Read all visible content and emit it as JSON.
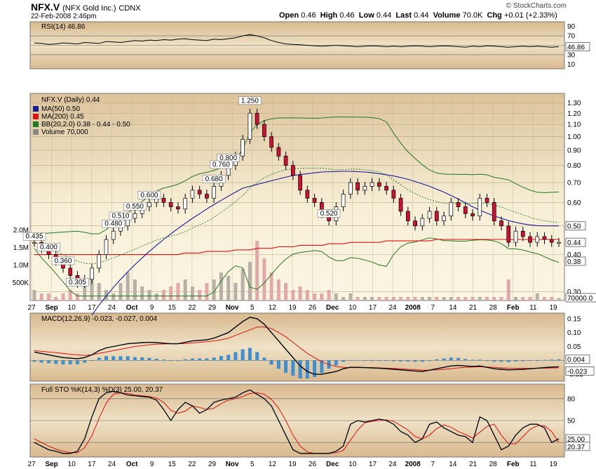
{
  "header": {
    "symbol": "NFX.V",
    "company": "(NFX Gold Inc.)",
    "exchange": "CDNX",
    "date": "22-Feb-2008 2:46pm",
    "brand": "© StockCharts.com",
    "open_label": "Open",
    "open": "0.46",
    "high_label": "High",
    "high": "0.46",
    "low_label": "Low",
    "low": "0.44",
    "last_label": "Last",
    "last": "0.44",
    "volume_label": "Volume",
    "volume": "70.0K",
    "chg_label": "Chg",
    "chg": "+0.01 (+2.33%)"
  },
  "colors": {
    "up_candle": "#ffffff",
    "down_candle": "#cc1133",
    "ma50": "#1a1a99",
    "ma200": "#dd1111",
    "bb": "#227722",
    "volume_up": "#b8b0a6",
    "volume_down": "#e2a8a8",
    "macd_hist": "#3d8fd0",
    "signal": "#dd1111"
  },
  "chart_data": [
    {
      "type": "line",
      "title": "RSI(14) 46.86",
      "series": [
        {
          "name": "RSI(14)",
          "values": [
            55,
            54,
            52,
            53,
            55,
            54,
            53,
            56,
            55,
            54,
            58,
            57,
            56,
            58,
            60,
            59,
            61,
            60,
            62,
            61,
            63,
            64,
            62,
            61,
            60,
            63,
            62,
            64,
            66,
            70,
            73,
            70,
            66,
            60,
            56,
            53,
            52,
            51,
            50,
            49,
            48,
            49,
            50,
            49,
            48,
            47,
            48,
            49,
            48,
            47,
            48,
            47,
            48,
            49,
            48,
            47,
            48,
            49,
            48,
            47,
            46,
            48,
            47,
            49,
            48,
            47,
            46,
            47,
            48,
            47,
            48,
            47,
            46,
            47
          ]
        }
      ],
      "ylim": [
        0,
        100
      ],
      "yticks": [
        "90",
        "70",
        "50",
        "30",
        "10"
      ],
      "last_value": "46.86"
    },
    {
      "type": "candlestick",
      "title": "NFX.V (Daily) 0.44",
      "legend": [
        "MA(50) 0.50",
        "MA(200) 0.45",
        "BB(20,2.0) 0.38 - 0.44 - 0.50",
        "Volume 70,000"
      ],
      "y_scale": "log",
      "ylim": [
        0.28,
        1.4
      ],
      "yticks": [
        "1.30",
        "1.20",
        "1.10",
        "1.00",
        "0.90",
        "0.80",
        "0.70",
        "0.60",
        "0.50",
        "0.40",
        "0.30"
      ],
      "volume_ticks": [
        "2.0M",
        "1.5M",
        "1.0M",
        "500K"
      ],
      "right_labels": [
        "0.50",
        "0.44",
        "0.38",
        "70000.0"
      ],
      "annotations": [
        {
          "text": "1.250",
          "value": 1.25
        },
        {
          "text": "0.800",
          "value": 0.8
        },
        {
          "text": "0.760",
          "value": 0.76
        },
        {
          "text": "0.680",
          "value": 0.68
        },
        {
          "text": "0.600",
          "value": 0.6
        },
        {
          "text": "0.550",
          "value": 0.55
        },
        {
          "text": "0.520",
          "value": 0.52
        },
        {
          "text": "0.510",
          "value": 0.51
        },
        {
          "text": "0.480",
          "value": 0.48
        },
        {
          "text": "0.435",
          "value": 0.435
        },
        {
          "text": "0.400",
          "value": 0.4
        },
        {
          "text": "0.360",
          "value": 0.36
        },
        {
          "text": "0.305",
          "value": 0.305
        }
      ],
      "close": [
        0.44,
        0.42,
        0.4,
        0.38,
        0.36,
        0.34,
        0.32,
        0.33,
        0.36,
        0.4,
        0.45,
        0.48,
        0.5,
        0.53,
        0.55,
        0.58,
        0.6,
        0.62,
        0.6,
        0.58,
        0.57,
        0.62,
        0.66,
        0.64,
        0.62,
        0.68,
        0.74,
        0.8,
        0.86,
        0.98,
        1.2,
        1.1,
        1.0,
        0.92,
        0.86,
        0.8,
        0.74,
        0.66,
        0.62,
        0.6,
        0.55,
        0.52,
        0.58,
        0.64,
        0.7,
        0.66,
        0.68,
        0.7,
        0.68,
        0.66,
        0.62,
        0.56,
        0.52,
        0.5,
        0.53,
        0.56,
        0.52,
        0.54,
        0.6,
        0.58,
        0.55,
        0.54,
        0.62,
        0.6,
        0.52,
        0.5,
        0.44,
        0.48,
        0.46,
        0.44,
        0.46,
        0.45,
        0.44,
        0.44
      ],
      "ma50": [
        null,
        null,
        null,
        null,
        null,
        null,
        null,
        null,
        0.25,
        0.27,
        0.29,
        0.31,
        0.33,
        0.35,
        0.37,
        0.39,
        0.41,
        0.43,
        0.45,
        0.47,
        0.49,
        0.51,
        0.53,
        0.55,
        0.57,
        0.59,
        0.61,
        0.63,
        0.65,
        0.67,
        0.68,
        0.69,
        0.7,
        0.71,
        0.72,
        0.73,
        0.74,
        0.745,
        0.75,
        0.755,
        0.76,
        0.762,
        0.763,
        0.764,
        0.764,
        0.762,
        0.76,
        0.756,
        0.75,
        0.744,
        0.737,
        0.728,
        0.718,
        0.706,
        0.693,
        0.68,
        0.665,
        0.65,
        0.633,
        0.616,
        0.598,
        0.58,
        0.565,
        0.552,
        0.54,
        0.53,
        0.521,
        0.514,
        0.508,
        0.504,
        0.501,
        0.5,
        0.5,
        0.5
      ],
      "ma200": [
        0.4,
        0.4,
        0.4,
        0.4,
        0.4,
        0.4,
        0.4,
        0.4,
        0.4,
        0.4,
        0.4,
        0.4,
        0.4,
        0.4,
        0.4,
        0.4,
        0.4,
        0.4,
        0.4,
        0.4,
        0.4,
        0.405,
        0.405,
        0.405,
        0.41,
        0.41,
        0.41,
        0.41,
        0.415,
        0.415,
        0.415,
        0.42,
        0.42,
        0.42,
        0.425,
        0.425,
        0.425,
        0.43,
        0.43,
        0.43,
        0.43,
        0.435,
        0.435,
        0.435,
        0.44,
        0.44,
        0.44,
        0.44,
        0.44,
        0.445,
        0.445,
        0.445,
        0.445,
        0.445,
        0.445,
        0.445,
        0.45,
        0.45,
        0.45,
        0.45,
        0.45,
        0.45,
        0.45,
        0.45,
        0.45,
        0.45,
        0.45,
        0.45,
        0.45,
        0.45,
        0.45,
        0.45,
        0.45,
        0.45
      ],
      "volume": [
        0.3,
        0.2,
        0.2,
        0.1,
        0.2,
        0.3,
        0.2,
        0.4,
        0.6,
        0.5,
        0.3,
        0.2,
        0.5,
        0.8,
        0.6,
        0.4,
        0.3,
        0.2,
        0.3,
        0.4,
        0.5,
        0.6,
        0.4,
        0.3,
        0.5,
        0.6,
        0.8,
        0.7,
        0.5,
        0.9,
        1.1,
        1.7,
        1.2,
        0.8,
        0.6,
        0.5,
        0.3,
        0.4,
        0.3,
        0.2,
        0.2,
        0.3,
        0.2,
        0.1,
        0.2,
        0.1,
        0.1,
        0.1,
        0.1,
        0.1,
        0.1,
        0.1,
        0.1,
        0.1,
        0.1,
        0.1,
        0.1,
        0.1,
        0.1,
        0.1,
        0.1,
        0.1,
        0.1,
        0.1,
        0.1,
        0.1,
        0.6,
        0.1,
        0.1,
        0.1,
        0.2,
        0.1,
        0.1,
        0.07
      ],
      "x_ticks": [
        "27",
        "Sep",
        "10",
        "17",
        "24",
        "Oct",
        "9",
        "15",
        "22",
        "29",
        "Nov",
        "5",
        "12",
        "19",
        "26",
        "Dec",
        "10",
        "17",
        "24",
        "2008",
        "7",
        "14",
        "21",
        "28",
        "Feb",
        "11",
        "19"
      ]
    },
    {
      "type": "line",
      "title": "MACD(12,26,9) -0.023, -0.027, 0.004",
      "series": [
        {
          "name": "MACD(12,26,9)",
          "values": [
            0.03,
            0.025,
            0.02,
            0.015,
            0.01,
            0.008,
            0.006,
            0.01,
            0.02,
            0.035,
            0.045,
            0.05,
            0.055,
            0.06,
            0.062,
            0.064,
            0.065,
            0.064,
            0.062,
            0.06,
            0.06,
            0.065,
            0.07,
            0.072,
            0.074,
            0.08,
            0.09,
            0.1,
            0.12,
            0.14,
            0.155,
            0.15,
            0.13,
            0.1,
            0.07,
            0.04,
            0.01,
            -0.02,
            -0.04,
            -0.05,
            -0.05,
            -0.045,
            -0.04,
            -0.03,
            -0.025,
            -0.025,
            -0.026,
            -0.027,
            -0.028,
            -0.03,
            -0.032,
            -0.034,
            -0.036,
            -0.038,
            -0.04,
            -0.035,
            -0.03,
            -0.025,
            -0.02,
            -0.018,
            -0.02,
            -0.022,
            -0.02,
            -0.025,
            -0.03,
            -0.032,
            -0.034,
            -0.033,
            -0.032,
            -0.03,
            -0.028,
            -0.026,
            -0.024,
            -0.023
          ]
        },
        {
          "name": "Signal",
          "values": [
            0.035,
            0.033,
            0.03,
            0.028,
            0.025,
            0.022,
            0.02,
            0.018,
            0.02,
            0.025,
            0.03,
            0.035,
            0.04,
            0.045,
            0.05,
            0.053,
            0.056,
            0.058,
            0.059,
            0.06,
            0.06,
            0.061,
            0.063,
            0.065,
            0.067,
            0.07,
            0.074,
            0.08,
            0.09,
            0.1,
            0.11,
            0.12,
            0.12,
            0.115,
            0.1,
            0.085,
            0.065,
            0.045,
            0.025,
            0.01,
            -0.005,
            -0.015,
            -0.022,
            -0.025,
            -0.026,
            -0.026,
            -0.026,
            -0.026,
            -0.027,
            -0.028,
            -0.029,
            -0.03,
            -0.032,
            -0.033,
            -0.035,
            -0.035,
            -0.034,
            -0.032,
            -0.03,
            -0.027,
            -0.025,
            -0.024,
            -0.023,
            -0.024,
            -0.025,
            -0.027,
            -0.028,
            -0.029,
            -0.029,
            -0.029,
            -0.028,
            -0.028,
            -0.027,
            -0.027
          ]
        }
      ],
      "ylim": [
        -0.075,
        0.17
      ],
      "yticks": [
        "0.15",
        "0.10",
        "0.05",
        "0.00",
        "-0.05"
      ],
      "right_labels": [
        "0.004",
        "-0.023"
      ]
    },
    {
      "type": "line",
      "title": "Full STO %K(14,3) %D(3) 25.00, 20.37",
      "series": [
        {
          "name": "%K(14,3)",
          "values": [
            20,
            15,
            10,
            8,
            5,
            5,
            8,
            25,
            55,
            80,
            88,
            90,
            88,
            85,
            84,
            83,
            82,
            78,
            65,
            50,
            65,
            75,
            70,
            60,
            65,
            75,
            78,
            80,
            82,
            88,
            92,
            86,
            80,
            70,
            50,
            30,
            10,
            5,
            5,
            5,
            5,
            5,
            8,
            15,
            45,
            50,
            48,
            50,
            52,
            50,
            45,
            35,
            30,
            20,
            25,
            45,
            48,
            40,
            35,
            30,
            28,
            20,
            55,
            50,
            30,
            10,
            15,
            30,
            40,
            45,
            45,
            40,
            20,
            25
          ]
        },
        {
          "name": "%D(3)",
          "values": [
            25,
            20,
            15,
            11,
            8,
            6,
            6,
            13,
            29,
            53,
            74,
            86,
            88,
            87,
            85,
            84,
            83,
            81,
            75,
            64,
            60,
            63,
            70,
            68,
            65,
            67,
            73,
            78,
            80,
            83,
            87,
            88,
            86,
            79,
            67,
            50,
            30,
            15,
            7,
            5,
            5,
            5,
            6,
            9,
            23,
            37,
            47,
            49,
            50,
            51,
            49,
            43,
            37,
            28,
            25,
            30,
            39,
            44,
            41,
            35,
            31,
            26,
            34,
            42,
            45,
            30,
            18,
            18,
            28,
            38,
            43,
            43,
            35,
            20
          ]
        }
      ],
      "ylim": [
        0,
        100
      ],
      "yticks": [
        "80",
        "50",
        "20"
      ],
      "right_labels": [
        "25.00",
        "20.37"
      ]
    }
  ]
}
